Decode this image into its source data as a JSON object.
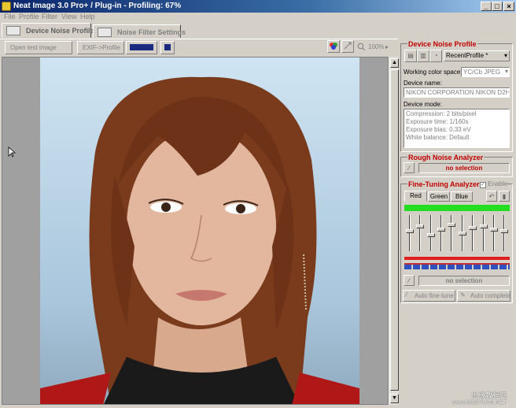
{
  "window": {
    "title": "Neat Image 3.0 Pro+ / Plug-in - Profiling: 67%",
    "minimize": "_",
    "restore": "□",
    "close": "×"
  },
  "menu": [
    "File",
    "Profile",
    "Filter",
    "View",
    "Help"
  ],
  "tabs": [
    {
      "label": "Device Noise Profile",
      "active": true
    },
    {
      "label": "Noise Filter Settings",
      "active": false
    }
  ],
  "toolbar": {
    "open_test_image": "Open test image",
    "exif_profile": "EXIF->Profile",
    "zoom": "100%"
  },
  "device_noise_profile": {
    "title": "Device Noise Profile",
    "profile_select": "RecentProfile *",
    "working_color_space_label": "Working color space:",
    "working_color_space": "YCrCb JPEG",
    "device_name_label": "Device name:",
    "device_name": "NIKON CORPORATION NIKON D2H",
    "device_mode_label": "Device mode:",
    "device_mode_lines": [
      "Compression: 2 bits/pixel",
      "Exposure time: 1/160s",
      "Exposure bias: 0.33 eV",
      "White balance: Default"
    ]
  },
  "rough_noise_analyzer": {
    "title": "Rough Noise Analyzer",
    "status": "no selection"
  },
  "fine_tuning_analyzer": {
    "title": "Fine-Tuning Analyzer",
    "enable_label": "Enable",
    "channels": [
      "Red",
      "Green",
      "Blue"
    ],
    "active_channel": "Red",
    "slider_levels": [
      0.55,
      0.7,
      0.45,
      0.6,
      0.75,
      0.5,
      0.65,
      0.7,
      0.6,
      0.55
    ],
    "status": "no selection",
    "auto_fine_tune": "Auto fine-tune",
    "auto_complete": "Auto complete",
    "colors": {
      "meter": "#22dd22",
      "red_bar": "#e02020"
    }
  },
  "watermark": {
    "line1": "思缘教程网",
    "line2": "www.MISSYUAN.NET"
  }
}
